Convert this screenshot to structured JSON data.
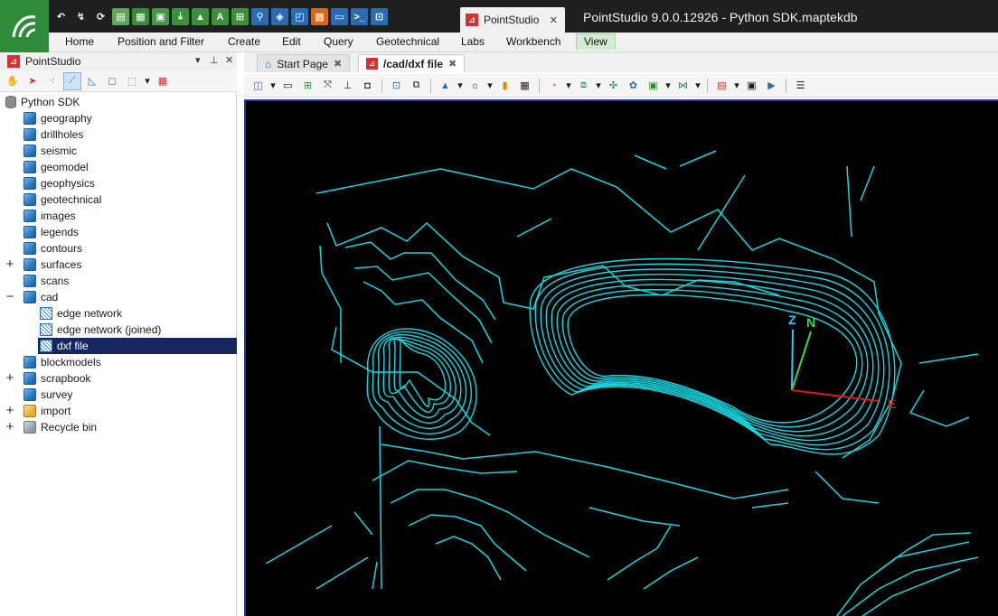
{
  "app": {
    "tab_title": "PointStudio",
    "window_title": "PointStudio 9.0.0.12926 - Python SDK.maptekdb",
    "brand_color": "#2e8b3a"
  },
  "quick_access": [
    "undo-icon",
    "redo-icon",
    "refresh-icon",
    "report-icon",
    "table-icon",
    "sheet-icon",
    "import-icon",
    "image-icon",
    "text-icon",
    "hierarchy-icon",
    "pin-icon",
    "cube-icon",
    "document-icon",
    "grid-icon",
    "monitor-icon",
    "console-icon",
    "export-icon"
  ],
  "ribbon": {
    "tabs": [
      "Home",
      "Position and Filter",
      "Create",
      "Edit",
      "Query",
      "Geotechnical",
      "Labs",
      "Workbench",
      "View"
    ],
    "active": "View"
  },
  "panel": {
    "title": "PointStudio",
    "pin": "pin-icon",
    "close": "close-icon"
  },
  "tree": {
    "root": "Python SDK",
    "items": [
      {
        "label": "geography",
        "icon": "container-icon"
      },
      {
        "label": "drillholes",
        "icon": "container-icon"
      },
      {
        "label": "seismic",
        "icon": "container-icon"
      },
      {
        "label": "geomodel",
        "icon": "container-icon"
      },
      {
        "label": "geophysics",
        "icon": "container-icon"
      },
      {
        "label": "geotechnical",
        "icon": "container-icon"
      },
      {
        "label": "images",
        "icon": "container-icon"
      },
      {
        "label": "legends",
        "icon": "container-icon"
      },
      {
        "label": "contours",
        "icon": "container-icon"
      },
      {
        "label": "surfaces",
        "icon": "container-icon",
        "expander": "+"
      },
      {
        "label": "scans",
        "icon": "container-icon"
      },
      {
        "label": "cad",
        "icon": "container-icon",
        "expander": "−"
      },
      {
        "label": "edge network",
        "icon": "edge-network-icon",
        "child": true
      },
      {
        "label": "edge network (joined)",
        "icon": "edge-network-icon",
        "child": true
      },
      {
        "label": "dxf file",
        "icon": "edge-network-icon",
        "child": true,
        "selected": true
      },
      {
        "label": "blockmodels",
        "icon": "container-icon"
      },
      {
        "label": "scrapbook",
        "icon": "container-icon",
        "expander": "+"
      },
      {
        "label": "survey",
        "icon": "container-icon"
      },
      {
        "label": "import",
        "icon": "import-folder-icon",
        "expander": "+"
      },
      {
        "label": "Recycle bin",
        "icon": "recycle-bin-icon",
        "expander": "+"
      }
    ]
  },
  "doc_tabs": [
    {
      "label": "Start Page",
      "icon": "home-icon"
    },
    {
      "label": "/cad/dxf file",
      "icon": "app-icon",
      "active": true
    }
  ],
  "viewport": {
    "background": "#000000",
    "line_color": "#14d7e0",
    "axes": {
      "z": "Z",
      "n": "N",
      "e": "E"
    }
  }
}
